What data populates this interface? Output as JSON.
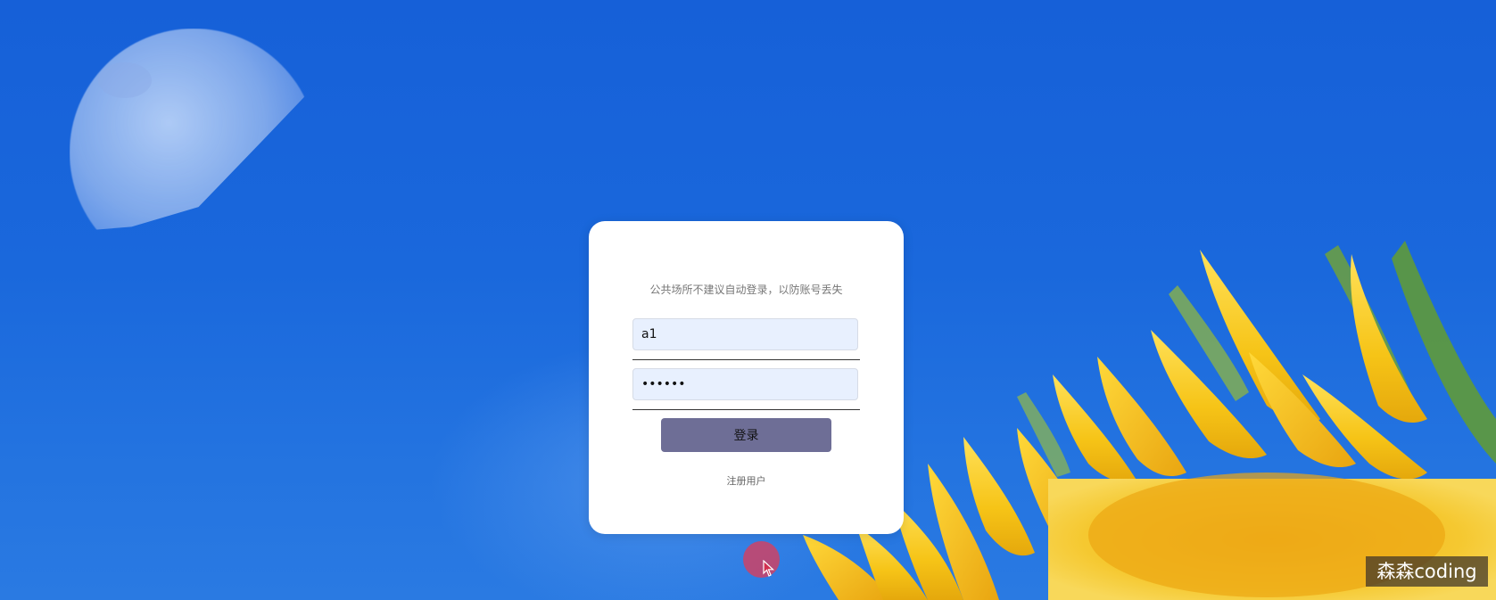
{
  "login": {
    "hint": "公共场所不建议自动登录，以防账号丢失",
    "username_value": "a1",
    "password_value": "123456",
    "login_button": "登录",
    "register_link": "注册用户"
  },
  "watermark": "森森coding",
  "colors": {
    "sky": "#1a66db",
    "card_bg": "#ffffff",
    "input_bg": "#e8f0fe",
    "button_bg": "#6e6e96",
    "petal": "#f5c61c",
    "cursor_highlight": "#dc3c5a"
  }
}
